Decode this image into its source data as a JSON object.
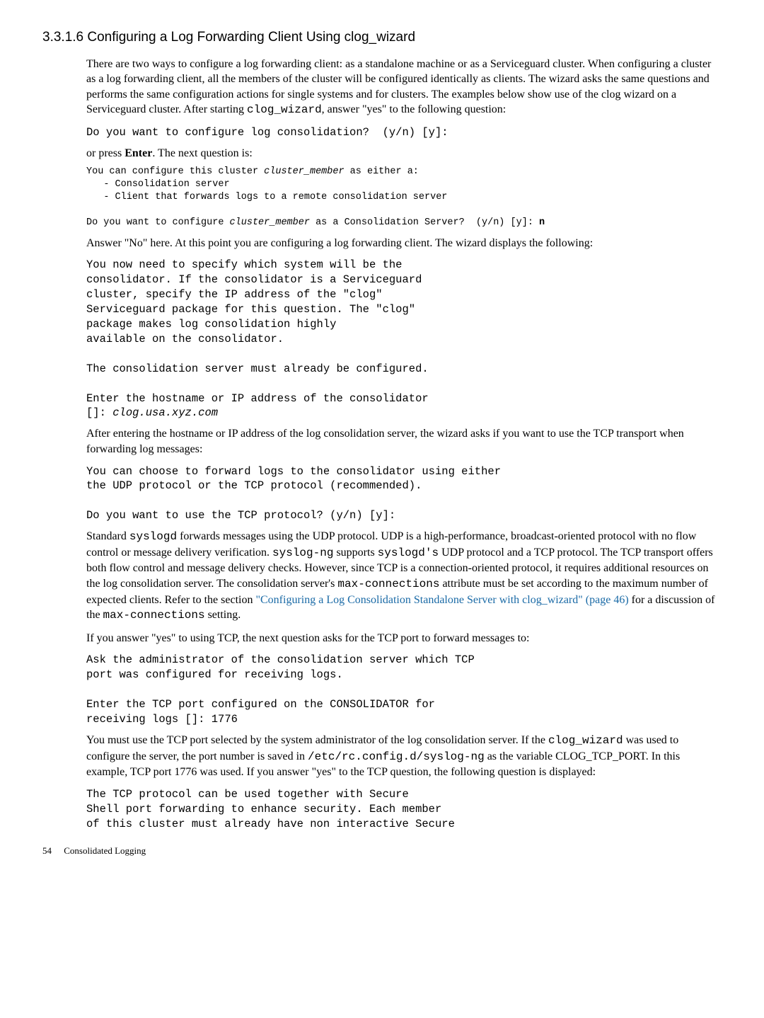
{
  "heading": "3.3.1.6 Configuring a Log Forwarding Client Using clog_wizard",
  "p1_a": "There are two ways to configure a log forwarding client: as a standalone machine or as a Serviceguard cluster. When configuring a cluster as a log forwarding client, all the members of the cluster will be configured identically as clients. The wizard asks the same questions and performs the same configuration actions for single systems and for clusters. The examples below show use of the clog wizard on a Serviceguard cluster. After starting ",
  "p1_mono": "clog_wizard",
  "p1_b": ", answer \"yes\" to the following question:",
  "code1": "Do you want to configure log consolidation?  (y/n) [y]:",
  "p2_a": "or press ",
  "p2_bold": "Enter",
  "p2_b": ". The next question is:",
  "sm1_a": "You can configure this cluster ",
  "sm1_i": "cluster_member",
  "sm1_b": " as either a:\n   - Consolidation server\n   - Client that forwards logs to a remote consolidation server\n\nDo you want to configure ",
  "sm1_i2": "cluster_member",
  "sm1_c": " as a Consolidation Server?  (y/n) [y]: ",
  "sm1_bold": "n",
  "p3": "Answer \"No\" here. At this point you are configuring a log forwarding client. The wizard displays the following:",
  "code2_a": "You now need to specify which system will be the\nconsolidator. If the consolidator is a Serviceguard\ncluster, specify the IP address of the \"clog\"\nServiceguard package for this question. The \"clog\"\npackage makes log consolidation highly\navailable on the consolidator.\n\nThe consolidation server must already be configured.\n\nEnter the hostname or IP address of the consolidator\n[]: ",
  "code2_i": "clog.usa.xyz.com",
  "p4": "After entering the hostname or IP address of the log consolidation server, the wizard asks if you want to use the TCP transport when forwarding log messages:",
  "code3": "You can choose to forward logs to the consolidator using either\nthe UDP protocol or the TCP protocol (recommended).\n\nDo you want to use the TCP protocol? (y/n) [y]:",
  "p5_1": "Standard ",
  "p5_m1": "syslogd",
  "p5_2": " forwards messages using the UDP protocol. UDP is a high-performance, broadcast-oriented protocol with no flow control or message delivery verification. ",
  "p5_m2": "syslog-ng",
  "p5_3": " supports ",
  "p5_m3": "syslogd's",
  "p5_4": " UDP protocol and a  TCP protocol. The TCP transport offers both flow control and message delivery checks. However, since TCP is a connection-oriented protocol, it requires additional resources on the log consolidation server. The consolidation server's ",
  "p5_m4": "max-connections",
  "p5_5": " attribute must be set according to the maximum number of expected clients. Refer to the section ",
  "p5_link": "\"Configuring a Log Consolidation Standalone Server with clog_wizard\" (page 46)",
  "p5_6": " for a discussion of the ",
  "p5_m5": "max-connections",
  "p5_7": " setting.",
  "p6": "If you answer \"yes\" to using TCP, the next question asks for the TCP port to forward messages to:",
  "code4": "Ask the administrator of the consolidation server which TCP\nport was configured for receiving logs.\n\nEnter the TCP port configured on the CONSOLIDATOR for\nreceiving logs []: 1776",
  "p7_1": "You must use the TCP port selected by the system administrator of the log consolidation server. If the ",
  "p7_m1": "clog_wizard",
  "p7_2": " was used to configure the server, the port number is saved in ",
  "p7_m2": "/etc/rc.config.d/syslog-ng",
  "p7_3": " as the variable CLOG_TCP_PORT. In this example, TCP port 1776 was used. If you answer \"yes\" to the TCP question, the following question is displayed:",
  "code5": "The TCP protocol can be used together with Secure\nShell port forwarding to enhance security. Each member\nof this cluster must already have non interactive Secure",
  "footer_page": "54",
  "footer_text": "Consolidated Logging"
}
